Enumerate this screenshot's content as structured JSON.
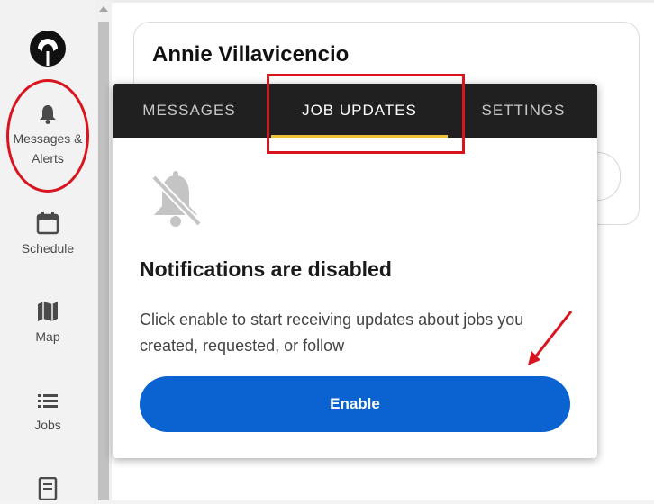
{
  "sidebar": {
    "items": [
      {
        "label": "Messages &\nAlerts",
        "icon": "bell-icon"
      },
      {
        "label": "Schedule",
        "icon": "calendar-icon"
      },
      {
        "label": "Map",
        "icon": "map-icon"
      },
      {
        "label": "Jobs",
        "icon": "list-icon"
      },
      {
        "label": "",
        "icon": "document-icon"
      }
    ]
  },
  "profile": {
    "name": "Annie Villavicencio"
  },
  "popover": {
    "tabs": [
      "MESSAGES",
      "JOB UPDATES",
      "SETTINGS"
    ],
    "active_tab": "JOB UPDATES",
    "title": "Notifications are disabled",
    "body": "Click enable to start receiving updates about jobs you created, requested, or follow",
    "enable_label": "Enable"
  },
  "colors": {
    "accent_blue": "#0a63d1",
    "tab_bg": "#202020",
    "active_underline": "#f0c23a",
    "annotation_red": "#d9141e"
  }
}
